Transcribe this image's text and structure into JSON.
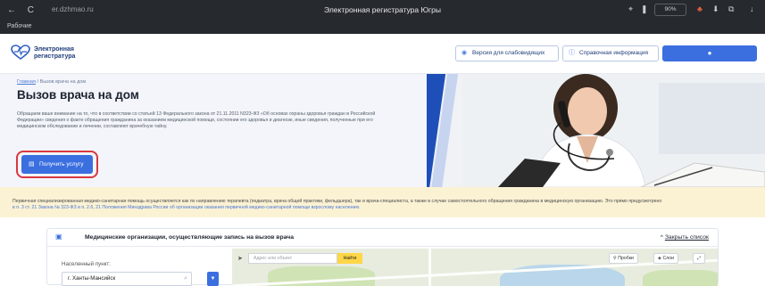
{
  "browser": {
    "nav_icons": "← C",
    "url": "er.dzhmao.ru",
    "title": "Электронная регистратура Югры",
    "bookmarks_label": "Рабочие",
    "zoom": "90%"
  },
  "header": {
    "logo_line1": "Электронная",
    "logo_line2": "регистратура",
    "btn_accessible": "Версия для слабовидящих",
    "btn_info": "Справочная информация",
    "btn_login_icon": "user-icon"
  },
  "hero": {
    "breadcrumb_home": "Главная",
    "breadcrumb_sep": " / ",
    "breadcrumb_current": "Вызов врача на дом",
    "title": "Вызов врача на дом",
    "description": "Обращаем ваше внимание на то, что в соответствии со статьей 13 Федерального закона от 21.11.2011 N323-ФЗ «Об основах охраны здоровья граждан в Российской Федерации» сведения о факте обращения гражданина за оказанием медицинской помощи, состоянии его здоровья и диагнозе, иные сведения, полученные при его медицинском обследовании и лечении, составляют врачебную тайну.",
    "cta_label": "Получить услугу"
  },
  "notice": {
    "line1": "Первичная специализированная медико-санитарная помощь осуществляется как по направлению терапевта (педиатра, врача общей практики, фельдшера), так и врача-специалиста, а также в случае самостоятельного обращения гражданина в медицинскую организацию. Это прямо предусмотрено",
    "line2": "в п. 3 ст. 21 Закона № 323-ФЗ и п. 2.6, 21 Положения Минздрава России об организации оказания первичной медико-санитарной помощи взрослому населению."
  },
  "panel": {
    "title": "Медицинские организации, осуществляющие запись на вызов врача",
    "close_label": "Закрыть список",
    "settlement_label": "Населенный пункт:",
    "settlement_value": "г. Ханты-Мансийск",
    "map_search_placeholder": "Адрес или объект",
    "map_find_label": "Найти",
    "map_traffic_label": "Пробки",
    "map_layers_label": "Слои"
  },
  "colors": {
    "accent": "#3b6fe0",
    "highlight_ring": "#d9383f",
    "notice_bg": "#fbf2d4"
  }
}
